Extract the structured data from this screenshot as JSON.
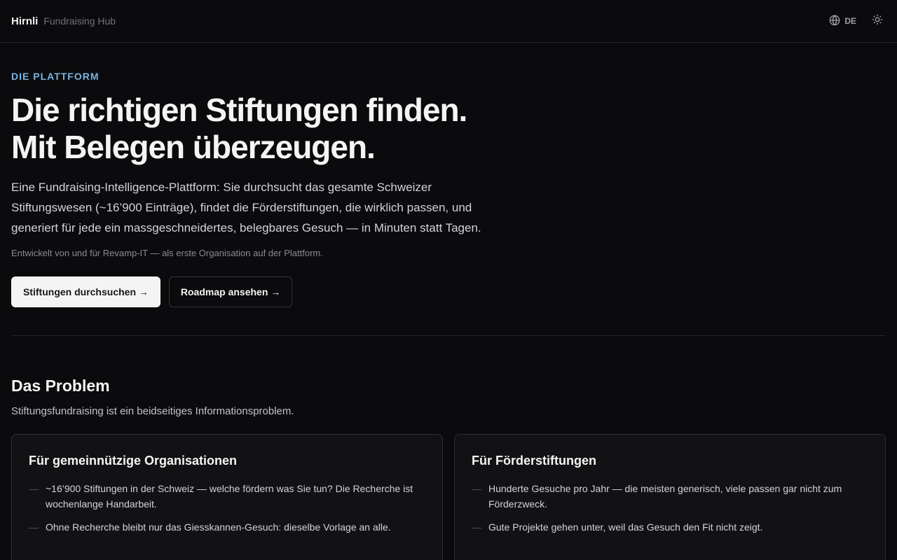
{
  "header": {
    "brand": "Hirnli",
    "subtitle": "Fundraising Hub",
    "language": "DE",
    "icons": {
      "language": "globe-icon",
      "theme": "sun-icon"
    }
  },
  "hero": {
    "eyebrow": "DIE PLATTFORM",
    "title_line1": "Die richtigen Stiftungen finden.",
    "title_line2": "Mit Belegen überzeugen.",
    "lead": "Eine Fundraising-Intelligence-Plattform: Sie durchsucht das gesamte Schweizer Stiftungswesen (~16’900 Einträge), findet die Förderstiftungen, die wirklich passen, und generiert für jede ein massgeschneidertes, belegbares Gesuch — in Minuten statt Tagen.",
    "note": "Entwickelt von und für Revamp-IT — als erste Organisation auf der Plattform.",
    "primary_cta": "Stiftungen durchsuchen →",
    "secondary_cta": "Roadmap ansehen →"
  },
  "problem": {
    "title": "Das Problem",
    "subtitle": "Stiftungsfundraising ist ein beidseitiges Informationsproblem.",
    "cards": [
      {
        "title": "Für gemeinnützige Organisationen",
        "items": [
          "~16’900 Stiftungen in der Schweiz — welche fördern was Sie tun? Die Recherche ist wochenlange Handarbeit.",
          "Ohne Recherche bleibt nur das Giesskannen-Gesuch: dieselbe Vorlage an alle."
        ]
      },
      {
        "title": "Für Förderstiftungen",
        "items": [
          "Hunderte Gesuche pro Jahr — die meisten generisch, viele passen gar nicht zum Förderzweck.",
          "Gute Projekte gehen unter, weil das Gesuch den Fit nicht zeigt."
        ]
      }
    ]
  },
  "colors": {
    "background": "#0b0b0d",
    "accent": "#7cb4e0",
    "card": "#121215"
  }
}
